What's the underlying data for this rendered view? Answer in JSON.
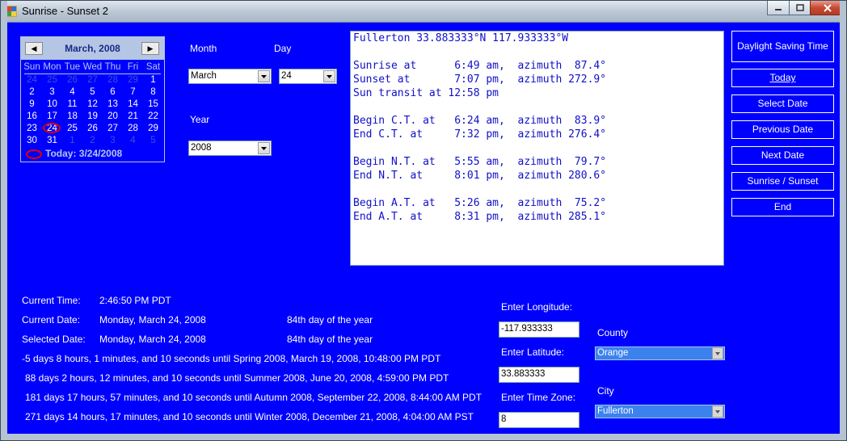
{
  "window": {
    "title": "Sunrise - Sunset 2"
  },
  "calendar": {
    "month_label": "March, 2008",
    "prev_glyph": "◀",
    "next_glyph": "▶",
    "dow": [
      "Sun",
      "Mon",
      "Tue",
      "Wed",
      "Thu",
      "Fri",
      "Sat"
    ],
    "weeks": [
      [
        "24",
        "25",
        "26",
        "27",
        "28",
        "29",
        "1"
      ],
      [
        "2",
        "3",
        "4",
        "5",
        "6",
        "7",
        "8"
      ],
      [
        "9",
        "10",
        "11",
        "12",
        "13",
        "14",
        "15"
      ],
      [
        "16",
        "17",
        "18",
        "19",
        "20",
        "21",
        "22"
      ],
      [
        "23",
        "24",
        "25",
        "26",
        "27",
        "28",
        "29"
      ],
      [
        "30",
        "31",
        "1",
        "2",
        "3",
        "4",
        "5"
      ]
    ],
    "today_label": "Today: 3/24/2008"
  },
  "month": {
    "label": "Month",
    "value": "March"
  },
  "day": {
    "label": "Day",
    "value": "24"
  },
  "year": {
    "label": "Year",
    "value": "2008"
  },
  "output_lines": [
    "Fullerton 33.883333°N 117.933333°W",
    "",
    "Sunrise at      6:49 am,  azimuth  87.4°",
    "Sunset at       7:07 pm,  azimuth 272.9°",
    "Sun transit at 12:58 pm",
    "",
    "Begin C.T. at   6:24 am,  azimuth  83.9°",
    "End C.T. at     7:32 pm,  azimuth 276.4°",
    "",
    "Begin N.T. at   5:55 am,  azimuth  79.7°",
    "End N.T. at     8:01 pm,  azimuth 280.6°",
    "",
    "Begin A.T. at   5:26 am,  azimuth  75.2°",
    "End A.T. at     8:31 pm,  azimuth 285.1°"
  ],
  "buttons": {
    "dst": "Daylight Saving Time",
    "today": "Today",
    "select_date": "Select Date",
    "previous_date": "Previous Date",
    "next_date": "Next Date",
    "sunrise_sunset": "Sunrise / Sunset",
    "end": "End"
  },
  "info": {
    "current_time_label": "Current Time:",
    "current_time": "2:46:50 PM PDT",
    "current_date_label": "Current Date:",
    "current_date": "Monday, March 24, 2008",
    "current_doy": "84th day of the year",
    "selected_date_label": "Selected Date:",
    "selected_date": "Monday, March 24, 2008",
    "selected_doy": "84th day of the year",
    "spring": "-5 days 8 hours, 1 minutes, and 10 seconds until Spring 2008, March 19, 2008, 10:48:00 PM PDT",
    "summer": "88 days 2 hours, 12 minutes, and 10 seconds until Summer 2008, June 20, 2008, 4:59:00 PM PDT",
    "autumn": "181 days 17 hours, 57 minutes, and 10 seconds until Autumn 2008, September 22, 2008, 8:44:00 AM PDT",
    "winter": "271 days 14 hours, 17 minutes, and 10 seconds until Winter 2008, December 21, 2008, 4:04:00 AM PST"
  },
  "location": {
    "longitude_label": "Enter Longitude:",
    "longitude": "-117.933333",
    "latitude_label": "Enter Latitude:",
    "latitude": "33.883333",
    "timezone_label": "Enter Time Zone:",
    "timezone": "8",
    "county_label": "County",
    "county": "Orange",
    "city_label": "City",
    "city": "Fullerton"
  }
}
